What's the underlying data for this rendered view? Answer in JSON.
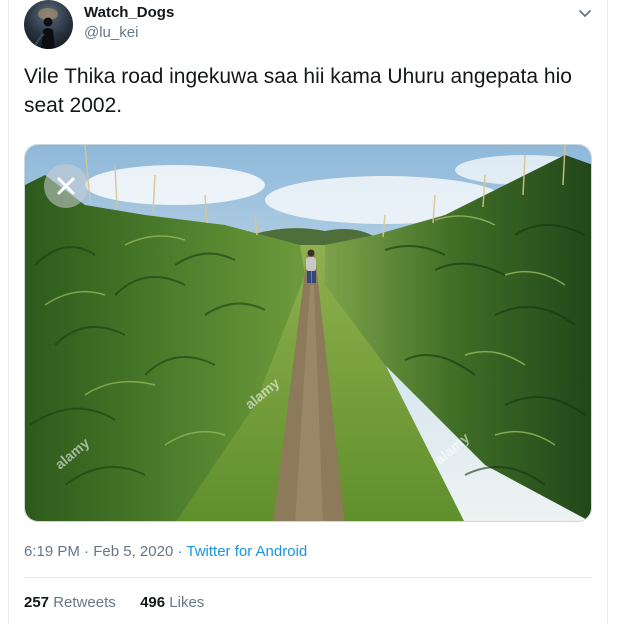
{
  "author": {
    "display_name": "Watch_Dogs",
    "handle": "@lu_kei"
  },
  "tweet": {
    "text": "Vile Thika road ingekuwa saa hii kama Uhuru angepata hio seat 2002."
  },
  "media": {
    "watermarks": [
      "alamy",
      "alamy",
      "alamy"
    ],
    "close_icon": "close-icon"
  },
  "meta": {
    "time": "6:19 PM",
    "separator": "·",
    "date": "Feb 5, 2020",
    "source": "Twitter for Android"
  },
  "stats": {
    "retweets_count": "257",
    "retweets_label": "Retweets",
    "likes_count": "496",
    "likes_label": "Likes"
  },
  "colors": {
    "link": "#1b95e0",
    "secondary_text": "#657786",
    "primary_text": "#14171a"
  }
}
